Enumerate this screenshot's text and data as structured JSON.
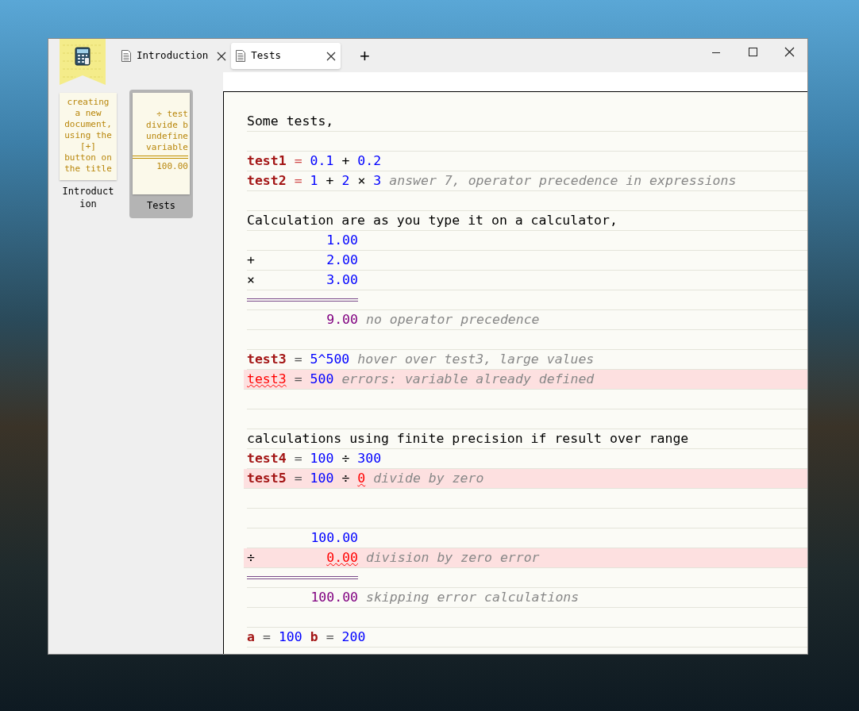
{
  "tabs": [
    {
      "label": "Introduction",
      "selected": false
    },
    {
      "label": "Tests",
      "selected": true
    }
  ],
  "new_tab": {
    "label": "+"
  },
  "documents": [
    {
      "label": "Introduction",
      "selected": false,
      "preview_lines": [
        {
          "kind": "text",
          "text": "creating"
        },
        {
          "kind": "text",
          "text": "a new"
        },
        {
          "kind": "text",
          "text": "document,"
        },
        {
          "kind": "text",
          "text": "using the"
        },
        {
          "kind": "text",
          "text": "[+]"
        },
        {
          "kind": "text",
          "text": "button on"
        },
        {
          "kind": "text",
          "text": "the title"
        }
      ]
    },
    {
      "label": "Tests",
      "selected": true,
      "preview_lines": [
        {
          "kind": "text",
          "text": "÷ test"
        },
        {
          "kind": "text",
          "text": "divide b"
        },
        {
          "kind": "text",
          "text": "undefine"
        },
        {
          "kind": "text",
          "text": "variable"
        },
        {
          "kind": "rule"
        },
        {
          "kind": "text",
          "text": "100.00"
        }
      ]
    }
  ],
  "lines": [
    {
      "kind": "text",
      "error": false,
      "text": "Some tests,"
    },
    {
      "kind": "blank",
      "error": false
    },
    {
      "kind": "expr",
      "error": false,
      "tokens": [
        {
          "kind": "var",
          "text": "test1"
        },
        {
          "kind": "eq",
          "text": "="
        },
        {
          "kind": "num",
          "text": "0.1"
        },
        {
          "kind": "op",
          "text": "+"
        },
        {
          "kind": "num",
          "text": "0.2"
        }
      ]
    },
    {
      "kind": "expr",
      "error": false,
      "tokens": [
        {
          "kind": "var",
          "text": "test2"
        },
        {
          "kind": "eq",
          "text": "="
        },
        {
          "kind": "num",
          "text": "1"
        },
        {
          "kind": "op",
          "text": "+"
        },
        {
          "kind": "num",
          "text": "2"
        },
        {
          "kind": "op",
          "text": "×"
        },
        {
          "kind": "num",
          "text": "3"
        },
        {
          "kind": "comment",
          "text": "answer 7, operator precedence in expressions"
        }
      ]
    },
    {
      "kind": "blank",
      "error": false
    },
    {
      "kind": "text",
      "error": false,
      "text": "Calculation are as you type it on a calculator,"
    },
    {
      "kind": "tape",
      "error": false,
      "value": {
        "kind": "num",
        "text": "1.00"
      }
    },
    {
      "kind": "tape",
      "error": false,
      "op": "+",
      "value": {
        "kind": "num",
        "text": "2.00"
      }
    },
    {
      "kind": "tape",
      "error": false,
      "op": "×",
      "value": {
        "kind": "num",
        "text": "3.00"
      }
    },
    {
      "kind": "rule",
      "error": false
    },
    {
      "kind": "tape",
      "error": false,
      "value": {
        "kind": "result",
        "text": "9.00"
      },
      "comment": "no operator precedence"
    },
    {
      "kind": "blank",
      "error": false
    },
    {
      "kind": "expr",
      "error": false,
      "tokens": [
        {
          "kind": "var",
          "text": "test3"
        },
        {
          "kind": "eq2",
          "text": "="
        },
        {
          "kind": "num",
          "text": "5^500"
        },
        {
          "kind": "comment",
          "text": "hover over test3, large values"
        }
      ]
    },
    {
      "kind": "expr",
      "error": true,
      "tokens": [
        {
          "kind": "bad",
          "text": "test3"
        },
        {
          "kind": "eq2",
          "text": "="
        },
        {
          "kind": "num",
          "text": "500"
        },
        {
          "kind": "comment",
          "text": "errors: variable already defined"
        }
      ]
    },
    {
      "kind": "blank",
      "error": false
    },
    {
      "kind": "blank",
      "error": false
    },
    {
      "kind": "text",
      "error": false,
      "text": "calculations using finite precision if result over range"
    },
    {
      "kind": "expr",
      "error": false,
      "tokens": [
        {
          "kind": "var",
          "text": "test4"
        },
        {
          "kind": "eq2",
          "text": "="
        },
        {
          "kind": "num",
          "text": "100"
        },
        {
          "kind": "op",
          "text": "÷"
        },
        {
          "kind": "num",
          "text": "300"
        }
      ]
    },
    {
      "kind": "expr",
      "error": true,
      "tokens": [
        {
          "kind": "var",
          "text": "test5"
        },
        {
          "kind": "eq2",
          "text": "="
        },
        {
          "kind": "num",
          "text": "100"
        },
        {
          "kind": "op",
          "text": "÷"
        },
        {
          "kind": "bad",
          "text": "0"
        },
        {
          "kind": "comment",
          "text": "divide by zero"
        }
      ]
    },
    {
      "kind": "blank",
      "error": false
    },
    {
      "kind": "blank",
      "error": false
    },
    {
      "kind": "tape",
      "error": false,
      "value": {
        "kind": "num",
        "text": "100.00"
      }
    },
    {
      "kind": "tape",
      "error": true,
      "op": "÷",
      "value": {
        "kind": "bad",
        "text": "0.00"
      },
      "comment": "division by zero error"
    },
    {
      "kind": "rule",
      "error": false
    },
    {
      "kind": "tape",
      "error": false,
      "value": {
        "kind": "result",
        "text": "100.00"
      },
      "comment": "skipping error calculations"
    },
    {
      "kind": "blank",
      "error": false
    },
    {
      "kind": "expr",
      "error": false,
      "tokens": [
        {
          "kind": "var",
          "text": "a"
        },
        {
          "kind": "eq2",
          "text": "="
        },
        {
          "kind": "num",
          "text": "100"
        },
        {
          "kind": "var",
          "text": "b"
        },
        {
          "kind": "eq2",
          "text": "="
        },
        {
          "kind": "num",
          "text": "200"
        }
      ]
    }
  ]
}
